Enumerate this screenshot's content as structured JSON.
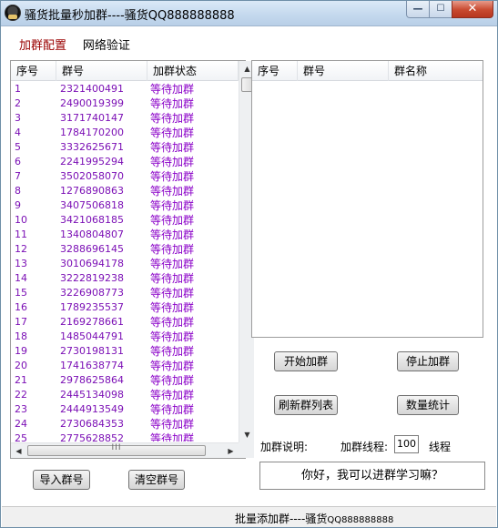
{
  "window": {
    "title": "骚货批量秒加群----骚货QQ888888888",
    "minimize_glyph": "—",
    "maximize_glyph": "☐",
    "close_glyph": "✕"
  },
  "tabs": [
    {
      "label": "加群配置",
      "active": true
    },
    {
      "label": "网络验证",
      "active": false
    }
  ],
  "left_list": {
    "columns": [
      "序号",
      "群号",
      "加群状态"
    ],
    "rows": [
      [
        "1",
        "2321400491",
        "等待加群"
      ],
      [
        "2",
        "2490019399",
        "等待加群"
      ],
      [
        "3",
        "3171740147",
        "等待加群"
      ],
      [
        "4",
        "1784170200",
        "等待加群"
      ],
      [
        "5",
        "3332625671",
        "等待加群"
      ],
      [
        "6",
        "2241995294",
        "等待加群"
      ],
      [
        "7",
        "3502058070",
        "等待加群"
      ],
      [
        "8",
        "1276890863",
        "等待加群"
      ],
      [
        "9",
        "3407506818",
        "等待加群"
      ],
      [
        "10",
        "3421068185",
        "等待加群"
      ],
      [
        "11",
        "1340804807",
        "等待加群"
      ],
      [
        "12",
        "3288696145",
        "等待加群"
      ],
      [
        "13",
        "3010694178",
        "等待加群"
      ],
      [
        "14",
        "3222819238",
        "等待加群"
      ],
      [
        "15",
        "3226908773",
        "等待加群"
      ],
      [
        "16",
        "1789235537",
        "等待加群"
      ],
      [
        "17",
        "2169278661",
        "等待加群"
      ],
      [
        "18",
        "1485044791",
        "等待加群"
      ],
      [
        "19",
        "2730198131",
        "等待加群"
      ],
      [
        "20",
        "1741638774",
        "等待加群"
      ],
      [
        "21",
        "2978625864",
        "等待加群"
      ],
      [
        "22",
        "2445134098",
        "等待加群"
      ],
      [
        "23",
        "2444913549",
        "等待加群"
      ],
      [
        "24",
        "2730684353",
        "等待加群"
      ],
      [
        "25",
        "2775628852",
        "等待加群"
      ]
    ],
    "colors": {
      "index": "#7b0fb5",
      "group": "#7b0fb5",
      "status": "#8a00c8"
    },
    "hscroll_grip": "III"
  },
  "right_list": {
    "columns": [
      "序号",
      "群号",
      "群名称"
    ]
  },
  "buttons": {
    "start": "开始加群",
    "stop": "停止加群",
    "refresh": "刷新群列表",
    "stats": "数量统计",
    "import": "导入群号",
    "clear": "清空群号"
  },
  "settings": {
    "description_label": "加群说明:",
    "threads_label": "加群线程:",
    "threads_value": "100",
    "threads_unit": "线程",
    "message": "你好，我可以进群学习嘛？"
  },
  "status": {
    "text_main": "批量添加群----骚货",
    "text_qq": "QQ888888888"
  },
  "accent": {
    "tab_active": "#9a0000",
    "close_button": "#c8492f"
  }
}
